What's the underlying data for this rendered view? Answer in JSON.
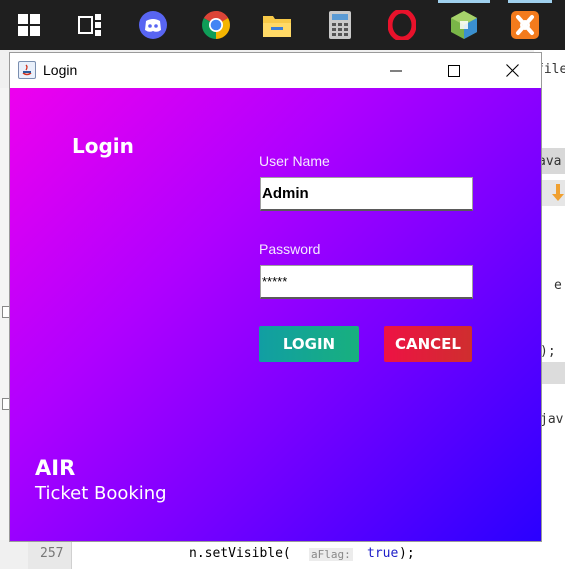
{
  "taskbar": {
    "icons": [
      "windows-start-icon",
      "task-view-icon",
      "discord-icon",
      "chrome-icon",
      "file-explorer-icon",
      "calculator-icon",
      "opera-icon",
      "virtualbox-icon",
      "xampp-icon"
    ]
  },
  "background_ide": {
    "fragments": [
      "file",
      "ava",
      "e",
      ");",
      "jav"
    ],
    "line_number": "257",
    "code_line": {
      "prefix": "n.setVisible(",
      "param_hint": "aFlag:",
      "value": "true",
      "suffix": ");"
    }
  },
  "window": {
    "title": "Login",
    "controls": {
      "minimize": "minimize-icon",
      "maximize": "maximize-icon",
      "close": "close-icon"
    }
  },
  "login_panel": {
    "heading": "Login",
    "brand_line1": "AIR",
    "brand_line2": "Ticket Booking",
    "username": {
      "label": "User Name",
      "value": "Admin"
    },
    "password": {
      "label": "Password",
      "value": "*****"
    },
    "login_button": "LOGIN",
    "cancel_button": "CANCEL",
    "colors": {
      "gradient_start": "#ee00ee",
      "gradient_end": "#2a00ff",
      "login_button": "#13a593",
      "cancel_button": "#e41a3c"
    }
  }
}
